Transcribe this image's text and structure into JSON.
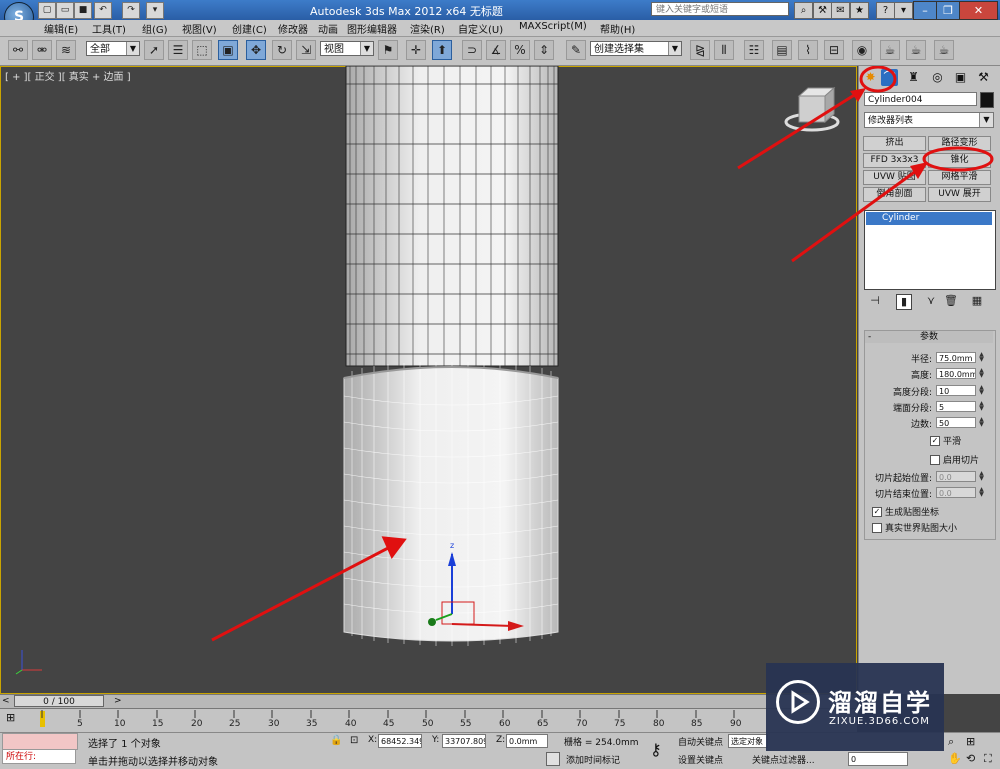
{
  "title": "Autodesk 3ds Max  2012 x64      无标题",
  "search": {
    "placeholder": "键入关键字或短语"
  },
  "menus": [
    "编辑(E)",
    "工具(T)",
    "组(G)",
    "视图(V)",
    "创建(C)",
    "修改器",
    "动画",
    "图形编辑器",
    "渲染(R)",
    "自定义(U)",
    "MAXScript(M)",
    "帮助(H)"
  ],
  "toolbar": {
    "filter_value": "全部",
    "ref_coord_value": "视图",
    "selection_set_value": "创建选择集"
  },
  "viewport": {
    "label": "[ + ][ 正交 ][ 真实 + 边面 ]"
  },
  "panel": {
    "object_name": "Cylinder004",
    "modifier_list": "修改器列表",
    "modifier_buttons": [
      "挤出",
      "路径变形",
      "FFD 3x3x3",
      "锥化",
      "UVW 贴图",
      "网格平滑",
      "倒角剖面",
      "UVW 展开"
    ],
    "stack_item": "Cylinder",
    "params": {
      "header": "参数",
      "rows": [
        {
          "label": "半径:",
          "value": "75.0mm"
        },
        {
          "label": "高度:",
          "value": "180.0mm"
        },
        {
          "label": "高度分段:",
          "value": "10"
        },
        {
          "label": "端面分段:",
          "value": "5"
        },
        {
          "label": "边数:",
          "value": "50"
        }
      ],
      "smooth": {
        "label": "平滑",
        "checked": true
      },
      "slice_on": {
        "label": "启用切片",
        "checked": false
      },
      "slice_from": {
        "label": "切片起始位置:",
        "value": "0.0"
      },
      "slice_to": {
        "label": "切片结束位置:",
        "value": "0.0"
      },
      "gen_map": {
        "label": "生成贴图坐标",
        "checked": true
      },
      "real_world": {
        "label": "真实世界贴图大小",
        "checked": false
      }
    }
  },
  "timeline": {
    "frame": "0 / 100",
    "ticks": [
      "5",
      "10",
      "15",
      "20",
      "25",
      "30",
      "35",
      "40",
      "45",
      "50",
      "55",
      "60",
      "65",
      "70",
      "75",
      "80",
      "85",
      "90"
    ]
  },
  "status": {
    "running": "所在行:",
    "selected": "选择了 1 个对象",
    "prompt": "单击并拖动以选择并移动对象",
    "x_label": "X:",
    "x_value": "68452.349",
    "y_label": "Y:",
    "y_value": "33707.809",
    "z_label": "Z:",
    "z_value": "0.0mm",
    "grid": "栅格 = 254.0mm",
    "add_time_tag": "添加时间标记",
    "auto_key": "自动关键点",
    "set_key": "设置关键点",
    "selected_filter": "选定对象",
    "key_filters": "关键点过滤器...",
    "frame_value": "0"
  },
  "watermark": {
    "brand": "溜溜自学",
    "url": "ZIXUE.3D66.COM"
  },
  "colors": {
    "annotation": "#e01010",
    "active_tab": "#2b6fc2",
    "selection_blue": "#3b78c7"
  }
}
